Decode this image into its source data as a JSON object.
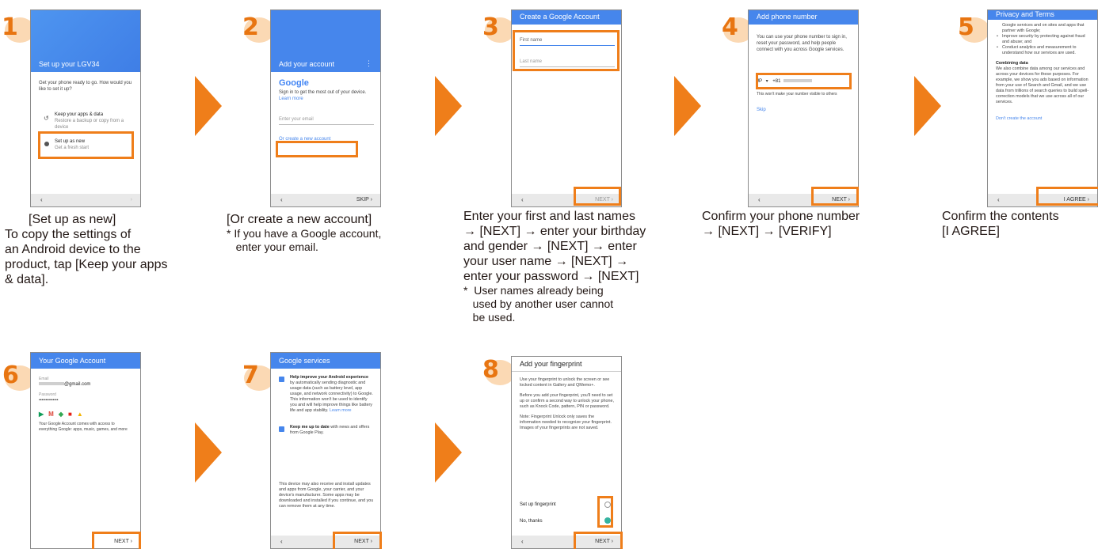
{
  "steps": [
    {
      "number": "1",
      "screen": {
        "title": "Set up your LGV34",
        "prompt": "Get your phone ready to go. How would you like to set it up?",
        "option1_title": "Keep your apps & data",
        "option1_sub": "Restore a backup or copy from a device",
        "option2_title": "Set up as new",
        "option2_sub": "Get a fresh start",
        "back": "‹",
        "fwd": "›"
      },
      "caption": {
        "title": "[Set up as new]",
        "lines": [
          "To copy the settings of",
          "an Android device to the",
          "product, tap [Keep your apps",
          "& data]."
        ]
      }
    },
    {
      "number": "2",
      "screen": {
        "title": "Add your account",
        "brand": "Google",
        "text": "Sign in to get the most out of your device.",
        "learn": "Learn more",
        "email_placeholder": "Enter your email",
        "create": "Or create a new account",
        "back": "‹",
        "skip": "SKIP  ›"
      },
      "caption": {
        "title": "[Or create a new account]",
        "note_lines": [
          "*  If you have a Google account,",
          "   enter your email."
        ]
      }
    },
    {
      "number": "3",
      "screen": {
        "title": "Create a Google Account",
        "first": "First name",
        "last": "Last name",
        "back": "‹",
        "next": "NEXT  ›"
      },
      "caption": {
        "lines": [
          "Enter your first and last names",
          "→ [NEXT] → enter your birthday",
          "and gender → [NEXT] → enter",
          "your user name → [NEXT] →",
          "enter your password → [NEXT]"
        ],
        "note_lines": [
          "*  User names already being",
          "   used by another user cannot",
          "   be used."
        ]
      }
    },
    {
      "number": "4",
      "screen": {
        "title": "Add phone number",
        "text": "You can use your phone number to sign in, reset your password, and help people connect with you across Google services.",
        "country": "JP",
        "code": "+81",
        "hint": "This won't make your number visible to others",
        "skip": "Skip",
        "back": "‹",
        "next": "NEXT  ›"
      },
      "caption": {
        "lines": [
          "Confirm your phone number",
          "→ [NEXT] → [VERIFY]"
        ]
      }
    },
    {
      "number": "5",
      "screen": {
        "title": "Privacy and Terms",
        "text1": "Google services and on sites and apps that partner with Google;",
        "bullet1": "Improve security by protecting against fraud and abuse; and",
        "bullet2": "Conduct analytics and measurement to understand how our services are used.",
        "heading": "Combining data",
        "text2": "We also combine data among our services and across your devices for these purposes. For example, we show you ads based on information from your use of Search and Gmail, and we use data from trillions of search queries to build spell-correction models that we use across all of our services.",
        "dont": "Don't create the account",
        "back": "‹",
        "agree": "I AGREE  ›"
      },
      "caption": {
        "lines": [
          "Confirm the contents",
          "[I AGREE]"
        ]
      }
    },
    {
      "number": "6",
      "screen": {
        "title": "Your Google Account",
        "email_label": "Email",
        "email_value": "@gmail.com",
        "password_label": "Password",
        "password_value": "••••••••••••••",
        "text": "Your Google Account comes with access to everything Google: apps, music, games, and more",
        "next": "NEXT  ›"
      }
    },
    {
      "number": "7",
      "screen": {
        "title": "Google services",
        "item1_bold": "Help improve your Android experience",
        "item1_text": "by automatically sending diagnostic and usage data (such as battery level, app usage, and network connectivity) to Google. This information won't be used to identify you and will help improve things like battery life and app stability.",
        "item1_link": "Learn more",
        "item2_bold": "Keep me up to date",
        "item2_text": "with news and offers from Google Play.",
        "text": "This device may also receive and install updates and apps from Google, your carrier, and your device's manufacturer. Some apps may be downloaded and installed if you continue, and you can remove them at any time.",
        "back": "‹",
        "next": "NEXT  ›"
      }
    },
    {
      "number": "8",
      "screen": {
        "title": "Add your fingerprint",
        "p1": "Use your fingerprint to unlock the screen or see locked content in Gallery and QMemo+.",
        "p2": "Before you add your fingerprint, you'll need to set up or confirm a second way to unlock your phone, such as Knock Code, pattern, PIN or password.",
        "p3": "Note: Fingerprint Unlock only saves the information needed to recognize your fingerprint. Images of your fingerprints are not saved.",
        "opt1": "Set up fingerprint",
        "opt2": "No, thanks",
        "back": "‹",
        "next": "NEXT  ›"
      }
    }
  ],
  "colors": {
    "accent": "#ef7e1a",
    "header_blue": "#4686ec",
    "badge": "#fbd9b4"
  }
}
